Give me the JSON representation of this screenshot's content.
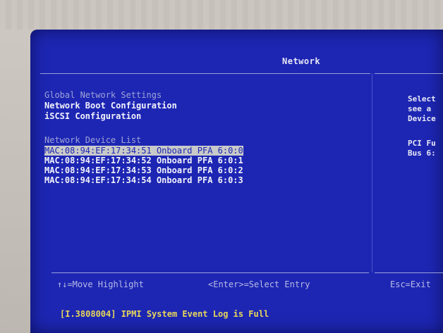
{
  "title": "Network",
  "menu": {
    "global_settings": "Global Network Settings",
    "boot_config": "Network Boot Configuration",
    "iscsi_config": "iSCSI Configuration"
  },
  "device_list": {
    "header": "Network Device List",
    "items": [
      "MAC:08:94:EF:17:34:51 Onboard PFA 6:0:0",
      "MAC:08:94:EF:17:34:52 Onboard PFA 6:0:1",
      "MAC:08:94:EF:17:34:53 Onboard PFA 6:0:2",
      "MAC:08:94:EF:17:34:54 Onboard PFA 6:0:3"
    ],
    "selected_index": 0
  },
  "help_panel": {
    "line1": "Select",
    "line2": "see a",
    "line3": "Device",
    "line4": "PCI Fu",
    "line5": "Bus 6:"
  },
  "footer": {
    "move": "↑↓=Move Highlight",
    "enter": "<Enter>=Select Entry",
    "esc": "Esc=Exit"
  },
  "status_message": "[I.3808004] IPMI System Event Log is Full",
  "colors": {
    "background": "#1d26b3",
    "highlight": "#c8c9c9",
    "status": "#e8d75a"
  }
}
